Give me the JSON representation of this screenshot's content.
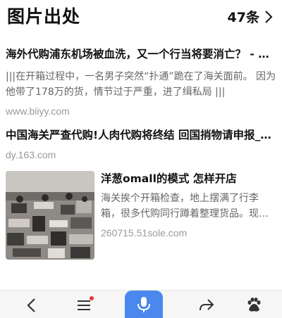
{
  "header": {
    "title": "图片出处",
    "count": "47条"
  },
  "results": [
    {
      "title": "海外代购浦东机场被血洗，又一个行当将要消亡？ - …",
      "snippet": "|||在开箱过程中，一名男子突然“扑通”跪在了海关面前。 因为他带了178万的货，情节过于严重，进了缉私局 |||",
      "url": "www.biiyy.com"
    },
    {
      "title": "中国海关严查代购!人肉代购将终结 回国捎物请申报_…",
      "url": "dy.163.com"
    },
    {
      "title": "洋葱omall的模式 怎样开店",
      "snippet": "海关挨个开箱检查，地上摆满了行李箱，很多代购同行蹲着整理货品。现…",
      "url": "260715.51sole.com"
    }
  ],
  "toolbar": {
    "back_icon": "back-icon",
    "menu_icon": "menu-icon",
    "voice_icon": "microphone-icon",
    "share_icon": "share-icon",
    "paw_icon": "baidu-paw-icon",
    "accent": "#4a88ee",
    "notify_color": "#e53935"
  }
}
